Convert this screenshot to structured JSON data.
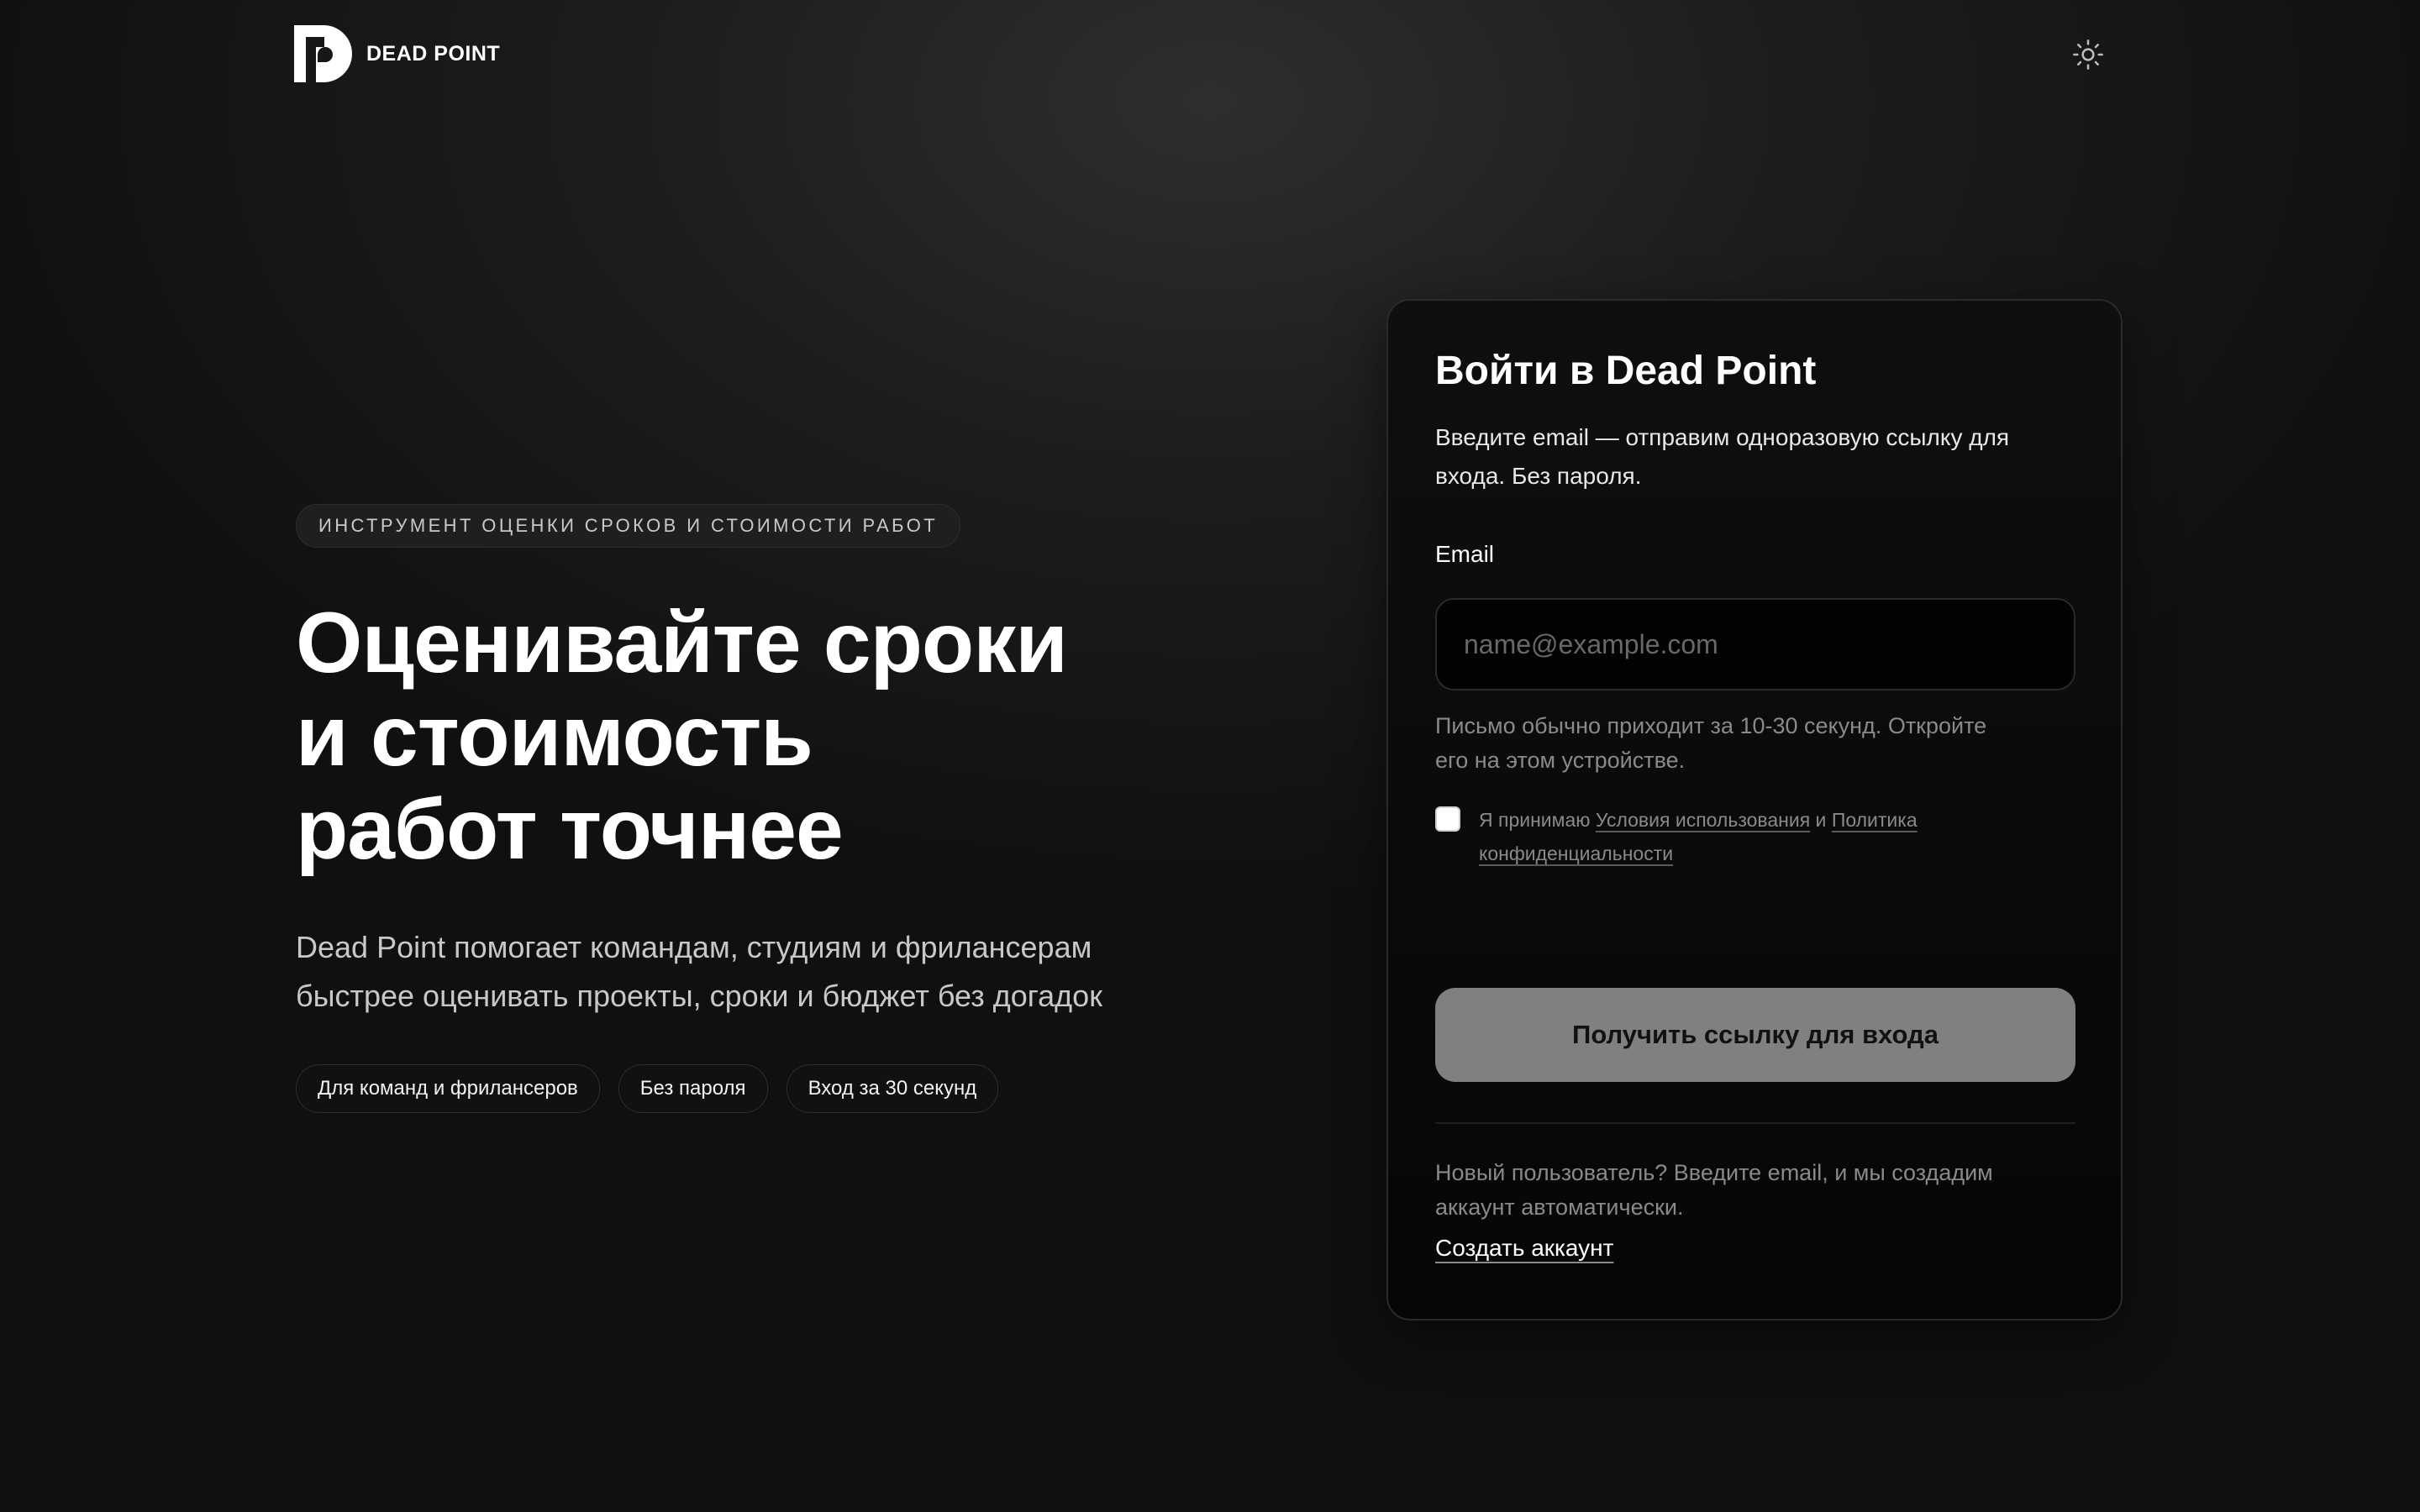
{
  "header": {
    "logo_text": "DEAD POINT",
    "theme_toggle_icon": "sun-icon"
  },
  "hero": {
    "eyebrow": "ИНСТРУМЕНТ ОЦЕНКИ СРОКОВ И СТОИМОСТИ РАБОТ",
    "title_lines": [
      "Оценивайте сроки",
      "и стоимость",
      "работ точнее"
    ],
    "subtitle_lines": [
      "Dead Point помогает командам, студиям и фрилансерам",
      "быстрее оценивать проекты, сроки и бюджет без догадок"
    ],
    "chips": [
      "Для команд и фрилансеров",
      "Без пароля",
      "Вход за 30 секунд"
    ]
  },
  "login": {
    "title": "Войти в Dead Point",
    "description_lines": [
      "Введите email — отправим одноразовую ссылку для",
      "входа. Без пароля."
    ],
    "email_label": "Email",
    "email_placeholder": "name@example.com",
    "email_value": "",
    "hint_lines": [
      "Письмо обычно приходит за 10-30 секунд. Откройте",
      "его на этом устройстве."
    ],
    "consent": {
      "checked": false,
      "prefix": "Я принимаю ",
      "terms_link": "Условия использования",
      "conjunction": " и ",
      "privacy_link_part1": "Политика",
      "privacy_link_part2": "конфиденциальности"
    },
    "submit_label": "Получить ссылку для входа",
    "new_user_lines": [
      "Новый пользователь? Введите email, и мы создадим",
      "аккаунт автоматически."
    ],
    "create_account_label": "Создать аккаунт"
  },
  "colors": {
    "background": "#1d1d1d",
    "card_background": "#0a0a0a",
    "button_background": "#808080",
    "muted_text": "#8a8a8a"
  }
}
